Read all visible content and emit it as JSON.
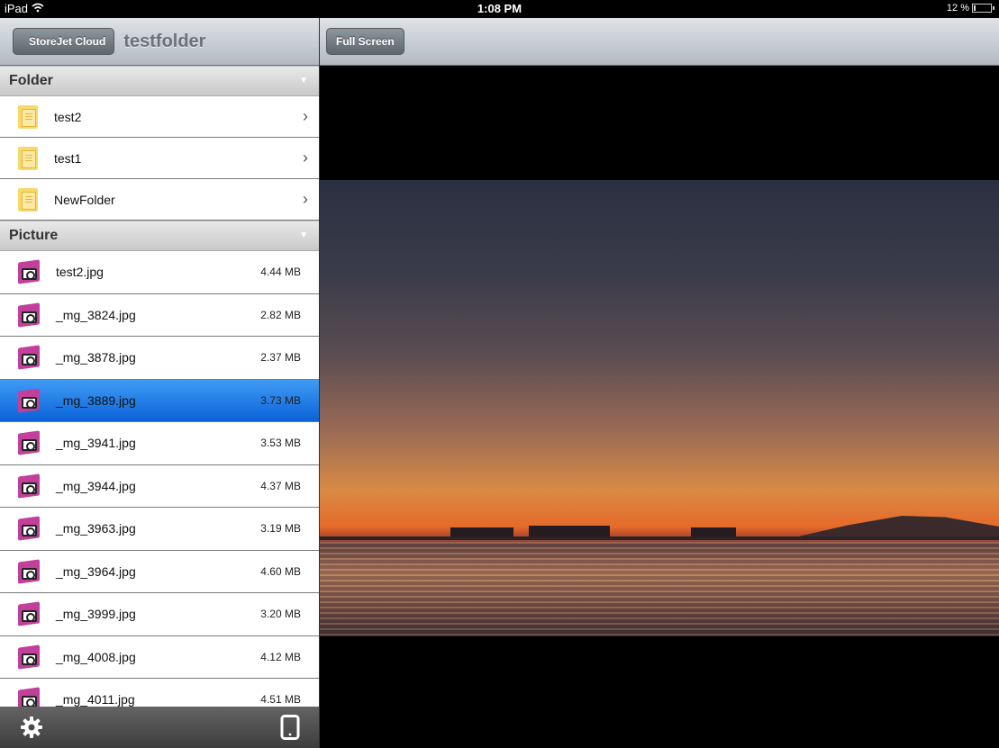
{
  "status_bar": {
    "device": "iPad",
    "time": "1:08 PM",
    "battery": "12 %",
    "battery_level": 0.12
  },
  "left_panel": {
    "back_button": "StoreJet Cloud",
    "title": "testfolder",
    "sections": {
      "folder": {
        "header": "Folder",
        "items": [
          {
            "name": "test2"
          },
          {
            "name": "test1"
          },
          {
            "name": "NewFolder"
          }
        ]
      },
      "picture": {
        "header": "Picture",
        "items": [
          {
            "name": "test2.jpg",
            "size": "4.44 MB"
          },
          {
            "name": "_mg_3824.jpg",
            "size": "2.82 MB"
          },
          {
            "name": "_mg_3878.jpg",
            "size": "2.37 MB"
          },
          {
            "name": "_mg_3889.jpg",
            "size": "3.73 MB",
            "selected": true
          },
          {
            "name": "_mg_3941.jpg",
            "size": "3.53 MB"
          },
          {
            "name": "_mg_3944.jpg",
            "size": "4.37 MB"
          },
          {
            "name": "_mg_3963.jpg",
            "size": "3.19 MB"
          },
          {
            "name": "_mg_3964.jpg",
            "size": "4.60 MB"
          },
          {
            "name": "_mg_3999.jpg",
            "size": "3.20 MB"
          },
          {
            "name": "_mg_4008.jpg",
            "size": "4.12 MB"
          },
          {
            "name": "_mg_4011.jpg",
            "size": "4.51 MB"
          }
        ]
      }
    },
    "toolbar": {
      "left_icon": "gear-icon",
      "right_icon": "device-icon"
    }
  },
  "right_panel": {
    "fullscreen_button": "Full Screen"
  },
  "colors": {
    "selection": "#1a6fe0",
    "navbar": "#c7cdd4",
    "toolbar": "#4f4f4f"
  }
}
